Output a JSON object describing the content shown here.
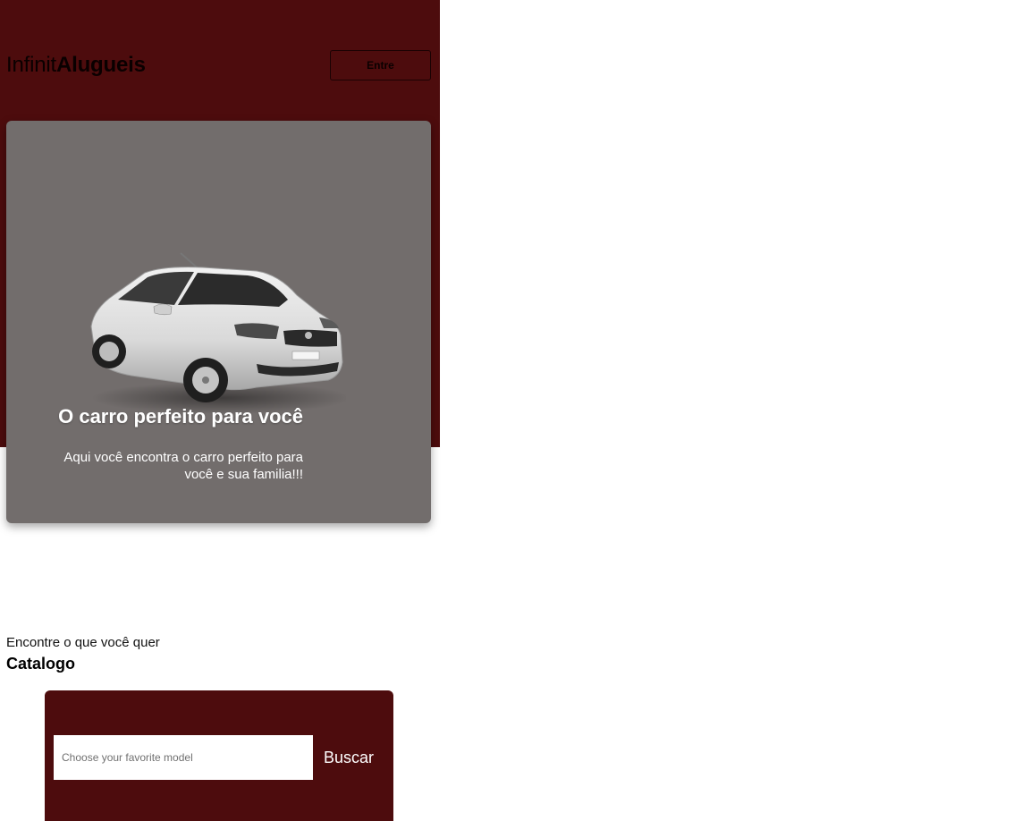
{
  "header": {
    "logo_light": "Infinit",
    "logo_bold": "Alugueis",
    "login_label": "Entre"
  },
  "hero": {
    "title": "O carro perfeito para você",
    "text": "Aqui você encontra o carro perfeito para você e sua familia!!!",
    "image_icon": "car-photo"
  },
  "catalog": {
    "subtitle": "Encontre o que você quer",
    "title": "Catalogo",
    "search_placeholder": "Choose your favorite model",
    "search_value": "",
    "search_button": "Buscar"
  },
  "colors": {
    "brand": "#4d0c0d",
    "hero_card": "#726d6c",
    "text_on_dark": "#ffffff"
  }
}
